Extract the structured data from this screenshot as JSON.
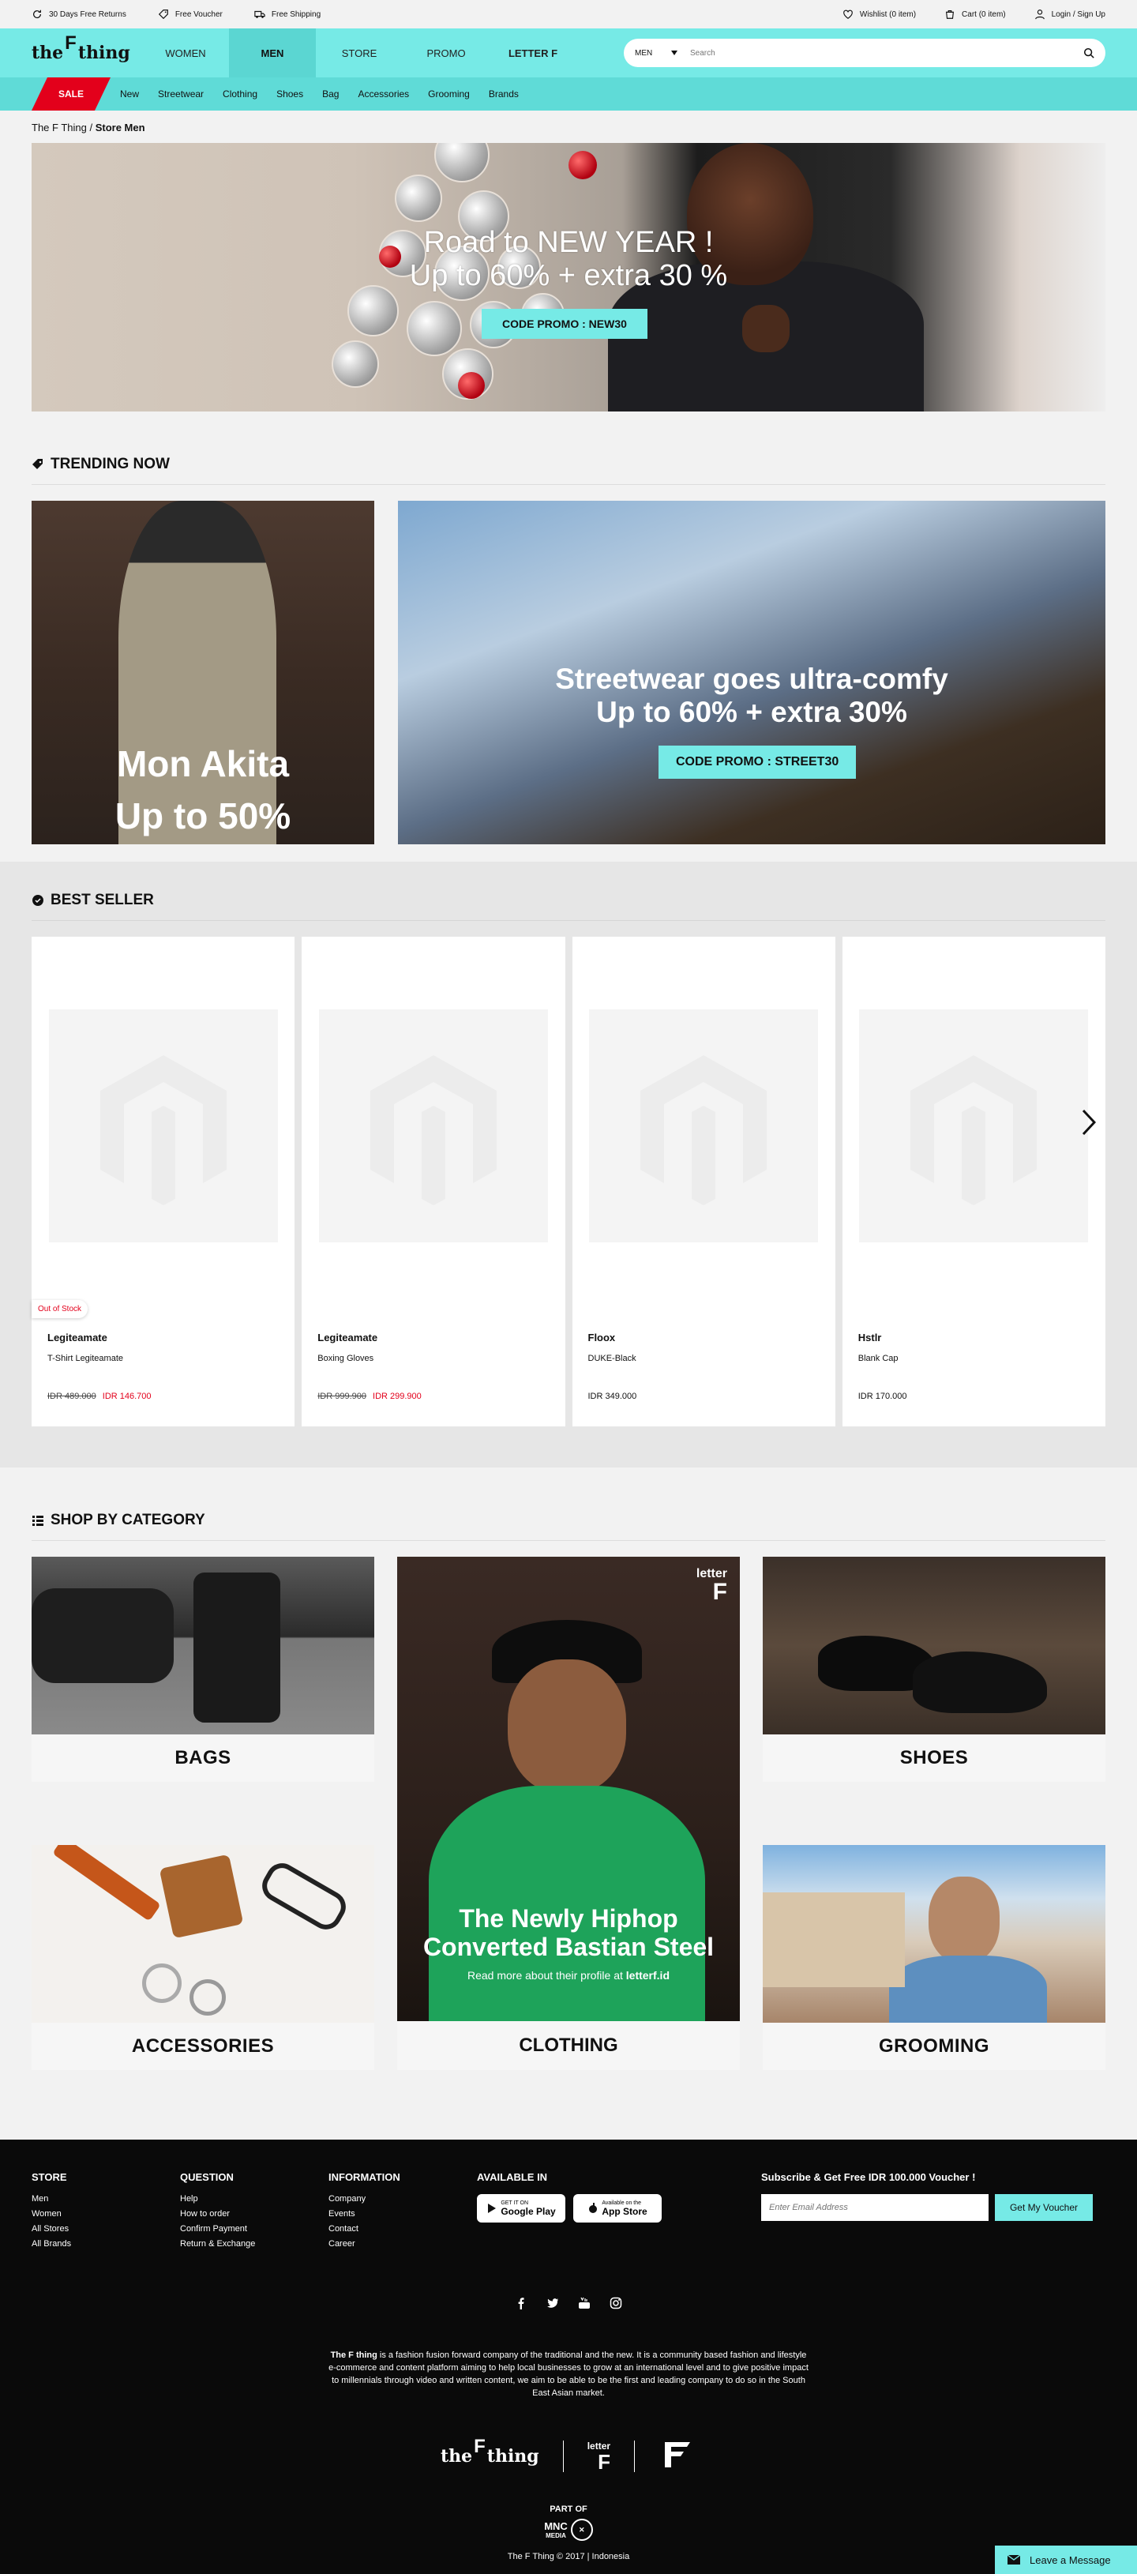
{
  "topbar": {
    "free_returns": "30 Days Free Returns",
    "free_voucher": "Free Voucher",
    "free_shipping": "Free Shipping",
    "wishlist": "Wishlist (0 item)",
    "cart": "Cart (0 item)",
    "login": "Login / Sign Up"
  },
  "header": {
    "logo_the": "the",
    "logo_f": "F",
    "logo_thing": "thing",
    "nav": [
      "WOMEN",
      "MEN",
      "STORE",
      "PROMO",
      "LETTER F"
    ],
    "search_category": "MEN",
    "search_placeholder": "Search"
  },
  "subnav": {
    "sale": "SALE",
    "items": [
      "New",
      "Streetwear",
      "Clothing",
      "Shoes",
      "Bag",
      "Accessories",
      "Grooming",
      "Brands"
    ]
  },
  "breadcrumb": {
    "root": "The F Thing",
    "sep": " / ",
    "current": "Store Men"
  },
  "hero": {
    "line1": "Road to NEW YEAR !",
    "line2": "Up to 60% + extra 30 %",
    "cta": "CODE PROMO : NEW30"
  },
  "trending": {
    "title": "TRENDING NOW",
    "left_line1": "Mon Akita",
    "left_line2": "Up to 50%",
    "right_line1": "Streetwear goes ultra-comfy",
    "right_line2": "Up to 60% + extra 30%",
    "right_cta": "CODE PROMO : STREET30"
  },
  "bestseller": {
    "title": "BEST SELLER",
    "products": [
      {
        "brand": "Legiteamate",
        "name": "T-Shirt Legiteamate",
        "old_price": "IDR 489.000",
        "price": "IDR 146.700",
        "badge": "Out of Stock"
      },
      {
        "brand": "Legiteamate",
        "name": "Boxing Gloves",
        "old_price": "IDR 999.900",
        "price": "IDR 299.900",
        "badge": ""
      },
      {
        "brand": "Floox",
        "name": "DUKE-Black",
        "old_price": "",
        "price": "IDR 349.000",
        "badge": ""
      },
      {
        "brand": "Hstlr",
        "name": "Blank Cap",
        "old_price": "",
        "price": "IDR 170.000",
        "badge": ""
      }
    ]
  },
  "categories": {
    "title": "SHOP BY CATEGORY",
    "bags": "BAGS",
    "shoes": "SHOES",
    "accessories": "ACCESSORIES",
    "clothing": "CLOTHING",
    "grooming": "GROOMING",
    "feature_logo_top": "letter",
    "feature_logo_f": "F",
    "feature_title_1": "The Newly Hiphop",
    "feature_title_2": "Converted Bastian Steel",
    "feature_sub_prefix": "Read more about their profile at ",
    "feature_sub_link": "letterf.id"
  },
  "footer": {
    "store": {
      "title": "STORE",
      "links": [
        "Men",
        "Women",
        "All Stores",
        "All Brands"
      ]
    },
    "question": {
      "title": "QUESTION",
      "links": [
        "Help",
        "How to order",
        "Confirm Payment",
        "Return & Exchange"
      ]
    },
    "information": {
      "title": "INFORMATION",
      "links": [
        "Company",
        "Events",
        "Contact",
        "Career"
      ]
    },
    "available": {
      "title": "AVAILABLE IN",
      "google_small": "GET IT ON",
      "google": "Google Play",
      "apple_small": "Available on the",
      "apple": "App Store"
    },
    "subscribe": {
      "title": "Subscribe & Get Free IDR 100.000 Voucher !",
      "placeholder": "Enter Email Address",
      "button": "Get My Voucher"
    },
    "about_bold": "The F thing",
    "about_text": " is a fashion fusion forward company of the traditional and the new. It is a community based fashion and lifestyle e-commerce and content platform aiming to help local businesses to grow at an international level and to give positive impact to millennials through video and written content, we aim to be able to be the first and leading company to do so in the South East Asian market.",
    "part_of": "PART OF",
    "mnc": "MNC",
    "mnc_media": "MEDIA",
    "copyright": "The F Thing © 2017 | Indonesia",
    "leave_message": "Leave a Message"
  },
  "colors": {
    "accent": "#76eae6",
    "sale": "#e3001b",
    "footer_bg": "#0a0a0a"
  }
}
